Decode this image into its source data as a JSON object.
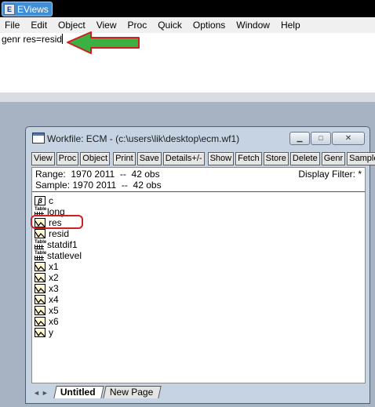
{
  "app": {
    "title": "EViews",
    "logo_glyph": "E"
  },
  "menu": [
    "File",
    "Edit",
    "Object",
    "View",
    "Proc",
    "Quick",
    "Options",
    "Window",
    "Help"
  ],
  "command": {
    "text": "genr res=resid"
  },
  "annotation": {
    "arrow_color": "#3cb043",
    "arrow_outline": "#d01f1f"
  },
  "workfile": {
    "title": "Workfile: ECM - (c:\\users\\lik\\desktop\\ecm.wf1)",
    "window_buttons": {
      "minimize": "▁",
      "maximize": "□",
      "close": "✕"
    },
    "toolbar": [
      "View",
      "Proc",
      "Object",
      "Print",
      "Save",
      "Details+/-",
      "Show",
      "Fetch",
      "Store",
      "Delete",
      "Genr",
      "Sample"
    ],
    "range_label": "Range:",
    "range_value": "1970 2011  --  42 obs",
    "sample_label": "Sample:",
    "sample_value": "1970 2011  --  42 obs",
    "display_filter": "Display Filter: *",
    "objects": [
      {
        "name": "c",
        "icon": "coefficient-icon"
      },
      {
        "name": "long",
        "icon": "table-icon"
      },
      {
        "name": "res",
        "icon": "series-icon"
      },
      {
        "name": "resid",
        "icon": "series-icon"
      },
      {
        "name": "statdif1",
        "icon": "table-icon"
      },
      {
        "name": "statlevel",
        "icon": "table-icon"
      },
      {
        "name": "x1",
        "icon": "series-icon"
      },
      {
        "name": "x2",
        "icon": "series-icon"
      },
      {
        "name": "x3",
        "icon": "series-icon"
      },
      {
        "name": "x4",
        "icon": "series-icon"
      },
      {
        "name": "x5",
        "icon": "series-icon"
      },
      {
        "name": "x6",
        "icon": "series-icon"
      },
      {
        "name": "y",
        "icon": "series-icon"
      }
    ],
    "tabs": [
      "Untitled",
      "New Page"
    ],
    "active_tab": "Untitled",
    "tab_arrows": [
      "◄",
      "►"
    ],
    "table_icon_label": "Table"
  }
}
